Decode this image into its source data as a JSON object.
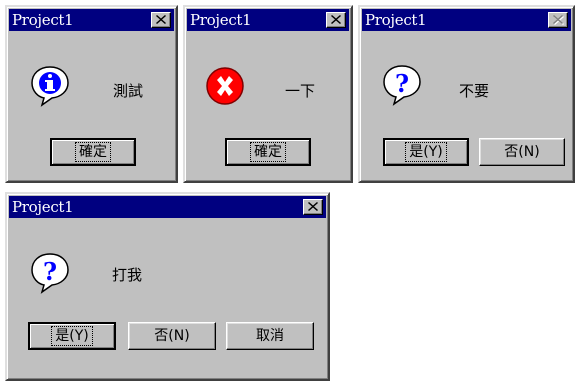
{
  "dialogs": [
    {
      "title": "Project1",
      "message": "測試",
      "icon": "information-icon",
      "buttons": [
        {
          "label": "確定",
          "default": true
        }
      ]
    },
    {
      "title": "Project1",
      "message": "一下",
      "icon": "error-icon",
      "buttons": [
        {
          "label": "確定",
          "default": true
        }
      ]
    },
    {
      "title": "Project1",
      "message": "不要",
      "icon": "question-icon",
      "close_disabled": true,
      "buttons": [
        {
          "label": "是(Y)",
          "default": true
        },
        {
          "label": "否(N)",
          "default": false
        }
      ]
    },
    {
      "title": "Project1",
      "message": "打我",
      "icon": "question-icon",
      "buttons": [
        {
          "label": "是(Y)",
          "default": true
        },
        {
          "label": "否(N)",
          "default": false
        },
        {
          "label": "取消",
          "default": false
        }
      ]
    }
  ],
  "colors": {
    "titlebar": "#000080",
    "face": "#c0c0c0",
    "error_red": "#ff0000",
    "info_blue": "#0000ff"
  }
}
